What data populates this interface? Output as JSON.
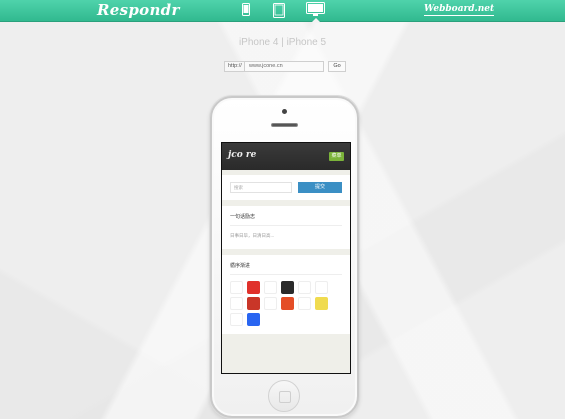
{
  "app": {
    "logo": "Respondr",
    "web_link": "Webboard.net",
    "device_title": "iPhone 4 | iPhone 5",
    "devices": [
      {
        "name": "phone",
        "active": false
      },
      {
        "name": "tablet",
        "active": false
      },
      {
        "name": "desktop",
        "active": true
      }
    ]
  },
  "urlbar": {
    "prefix": "http://",
    "value": "www.jcone.cn",
    "go_label": "Go"
  },
  "site": {
    "logo": "jco re",
    "menu_label": "菜单",
    "search": {
      "placeholder": "搜索",
      "button_label": "提交"
    },
    "motto": {
      "title": "一句话励志",
      "text": "日事日毕，日清日高..."
    },
    "reading": {
      "title": "循序渐进",
      "icons": [
        {
          "name": "java-icon",
          "color": "#ffffff",
          "fg": "#d33",
          "label": "J"
        },
        {
          "name": "oracle-icon",
          "color": "#e0312b",
          "fg": "#fff",
          "label": "O"
        },
        {
          "name": "mysql-icon",
          "color": "#ffffff",
          "fg": "#e48e00",
          "label": "My"
        },
        {
          "name": "terminal-icon",
          "color": "#2a2a2a",
          "fg": "#fff",
          "label": ">_"
        },
        {
          "name": "python-icon",
          "color": "#ffffff",
          "fg": "#3b76b0",
          "label": "Py"
        },
        {
          "name": "golang-icon",
          "color": "#ffffff",
          "fg": "#2aa34a",
          "label": "G"
        },
        {
          "name": "scala-icon",
          "color": "#ffffff",
          "fg": "#c22",
          "label": "S"
        },
        {
          "name": "redis-icon",
          "color": "#c93628",
          "fg": "#fff",
          "label": "R"
        },
        {
          "name": "gem-icon",
          "color": "#ffffff",
          "fg": "#c22",
          "label": "◆"
        },
        {
          "name": "html5-icon",
          "color": "#e44d26",
          "fg": "#fff",
          "label": "5"
        },
        {
          "name": "nodejs-icon",
          "color": "#ffffff",
          "fg": "#6aa84f",
          "label": "N"
        },
        {
          "name": "js-icon",
          "color": "#f0db4f",
          "fg": "#222",
          "label": "JS"
        },
        {
          "name": "node-hex-icon",
          "color": "#ffffff",
          "fg": "#5a9e3a",
          "label": "⬡"
        },
        {
          "name": "css3-icon",
          "color": "#2965f1",
          "fg": "#fff",
          "label": "3"
        }
      ]
    }
  }
}
